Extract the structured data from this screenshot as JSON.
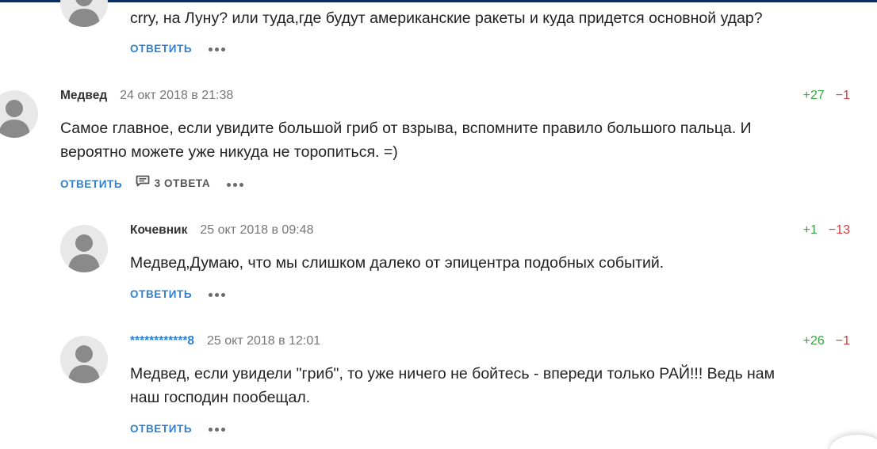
{
  "comments": [
    {
      "author": "",
      "date": "",
      "plus": "",
      "minus": "",
      "text_lines": [
        "crry, на Луну? или туда,где будут американские ракеты и куда придется основной удар?"
      ],
      "reply_label": "ОТВЕТИТЬ",
      "replies_label": ""
    },
    {
      "author": "Медвед",
      "date": "24 окт 2018 в 21:38",
      "plus": "+27",
      "minus": "−1",
      "text_lines": [
        "Самое главное, если увидите большой гриб от взрыва, вспомните правило большого пальца. И",
        "вероятно можете уже никуда не торопиться. =)"
      ],
      "reply_label": "ОТВЕТИТЬ",
      "replies_label": "3 ОТВЕТА"
    },
    {
      "author": "Кочевник",
      "date": "25 окт 2018 в 09:48",
      "plus": "+1",
      "minus": "−13",
      "text_lines": [
        "Медвед,Думаю, что мы слишком далеко от эпицентра подобных событий."
      ],
      "reply_label": "ОТВЕТИТЬ",
      "replies_label": ""
    },
    {
      "author": "************8",
      "date": "25 окт 2018 в 12:01",
      "plus": "+26",
      "minus": "−1",
      "text_lines": [
        "Медвед, если увидели \"гриб\", то уже ничего не бойтесь - впереди только РАЙ!!! Ведь нам",
        "наш господин пообещал."
      ],
      "reply_label": "ОТВЕТИТЬ",
      "replies_label": ""
    }
  ],
  "icons": {
    "avatar": "user-silhouette-icon",
    "replies": "speech-bubble-icon",
    "more": "more-dots-icon"
  },
  "colors": {
    "link": "#2f80d1",
    "vote_plus": "#3aa343",
    "vote_minus": "#d43b3b",
    "avatar_bg": "#e8e8e8",
    "avatar_fg": "#8a8a8a"
  }
}
